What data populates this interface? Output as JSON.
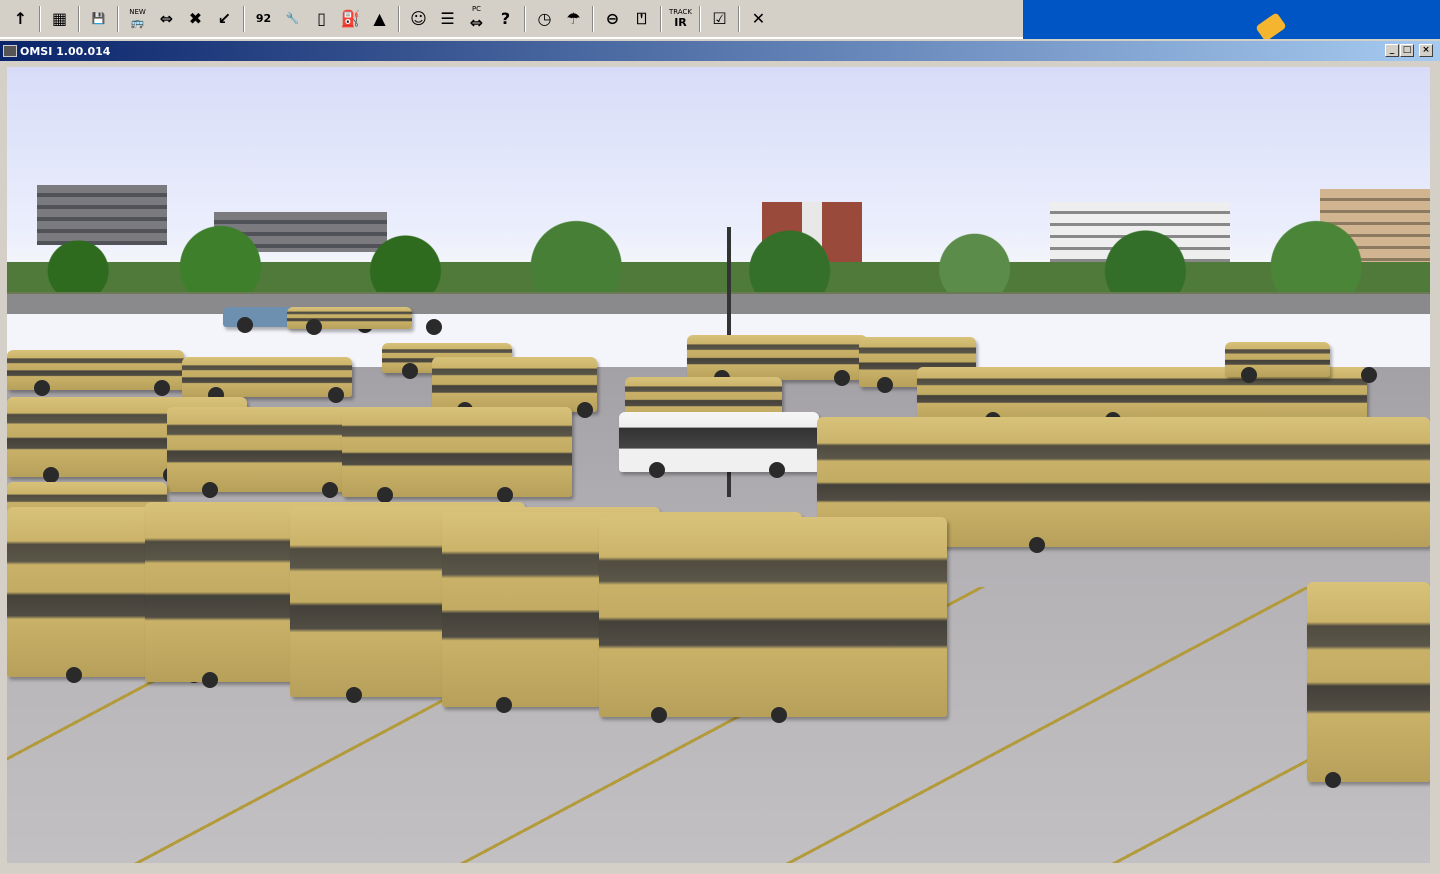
{
  "app": {
    "title": "OMSI 1.00.014"
  },
  "toolbar": {
    "items": [
      {
        "name": "up-arrow-icon",
        "glyph": "↑"
      },
      {
        "name": "map-icon",
        "glyph": "▦"
      },
      {
        "name": "save-icon",
        "glyph": "💾"
      },
      {
        "name": "new-bus-icon",
        "glyph": "🚌",
        "label": "NEW"
      },
      {
        "name": "switch-bus-icon",
        "glyph": "⇔"
      },
      {
        "name": "delete-bus-icon",
        "glyph": "✖"
      },
      {
        "name": "pointer-icon",
        "glyph": "↙"
      },
      {
        "name": "route-number-icon",
        "glyph": "92"
      },
      {
        "name": "wrench-icon",
        "glyph": "🔧"
      },
      {
        "name": "bus-front-icon",
        "glyph": "▯"
      },
      {
        "name": "fuel-pump-icon",
        "glyph": "⛽"
      },
      {
        "name": "bell-icon",
        "glyph": "▲"
      },
      {
        "name": "driver-icon",
        "glyph": "☺"
      },
      {
        "name": "timetable-icon",
        "glyph": "☰"
      },
      {
        "name": "pc-driver-switch-icon",
        "glyph": "⇔",
        "label": "PC"
      },
      {
        "name": "help-arrow-icon",
        "glyph": "?"
      },
      {
        "name": "clock-icon",
        "glyph": "◷"
      },
      {
        "name": "weather-icon",
        "glyph": "☂"
      },
      {
        "name": "steering-wheel-icon",
        "glyph": "⊖"
      },
      {
        "name": "mouse-icon",
        "glyph": "⍞"
      },
      {
        "name": "trackir-icon",
        "glyph": "IR",
        "label": "TRACK"
      },
      {
        "name": "checkbox-options-icon",
        "glyph": "☑"
      },
      {
        "name": "close-x-icon",
        "glyph": "✕"
      }
    ]
  },
  "window_buttons": {
    "minimize": "_",
    "maximize": "□",
    "close": "×"
  },
  "colors": {
    "titlebar_start": "#0a246a",
    "titlebar_end": "#a6caf0",
    "bus_yellow": "#cbb36a"
  }
}
